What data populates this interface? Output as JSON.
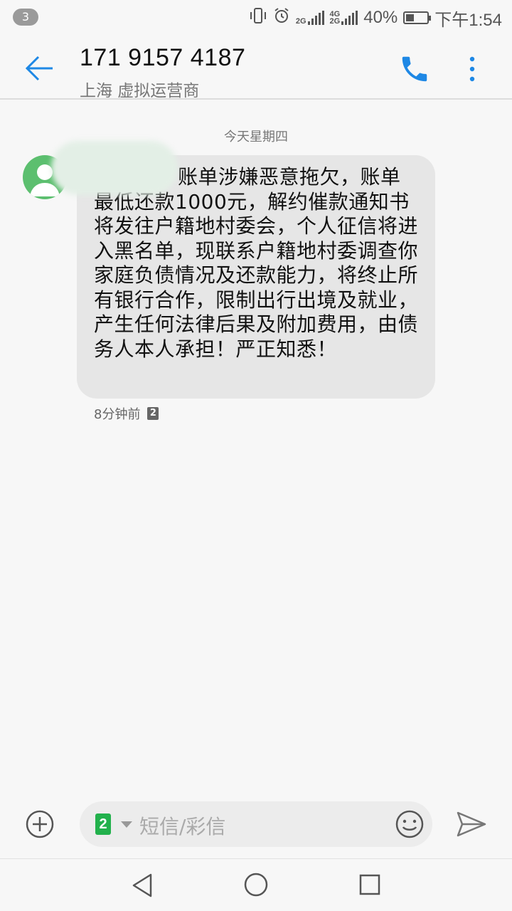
{
  "status_bar": {
    "notification_count": "3",
    "net_1": "2G",
    "net_2": "4G\n2G",
    "battery_percent": "40%",
    "battery_level": 0.4,
    "time": "下午1:54"
  },
  "header": {
    "contact_number": "171 9157 4187",
    "contact_location": "上海 虚拟运营商"
  },
  "conversation": {
    "date_divider": "今天星期四",
    "messages": [
      {
        "text": "账单涉嫌恶意拖欠，账单最低还款1000元，解约催款通知书将发往户籍地村委会，个人征信将进入黑名单，现联系户籍地村委调查你家庭负债情况及还款能力，将终止所有银行合作，限制出行出境及就业，产生任何法律后果及附加费用，由债务人本人承担！严正知悉！",
        "time": "8分钟前",
        "sim": "2"
      }
    ]
  },
  "compose": {
    "sim_label": "2",
    "placeholder": "短信/彩信"
  },
  "colors": {
    "accent": "#1e88e5",
    "avatar_green": "#5cbf6f",
    "sim_green": "#22b14c",
    "bubble": "#e6e6e6"
  }
}
